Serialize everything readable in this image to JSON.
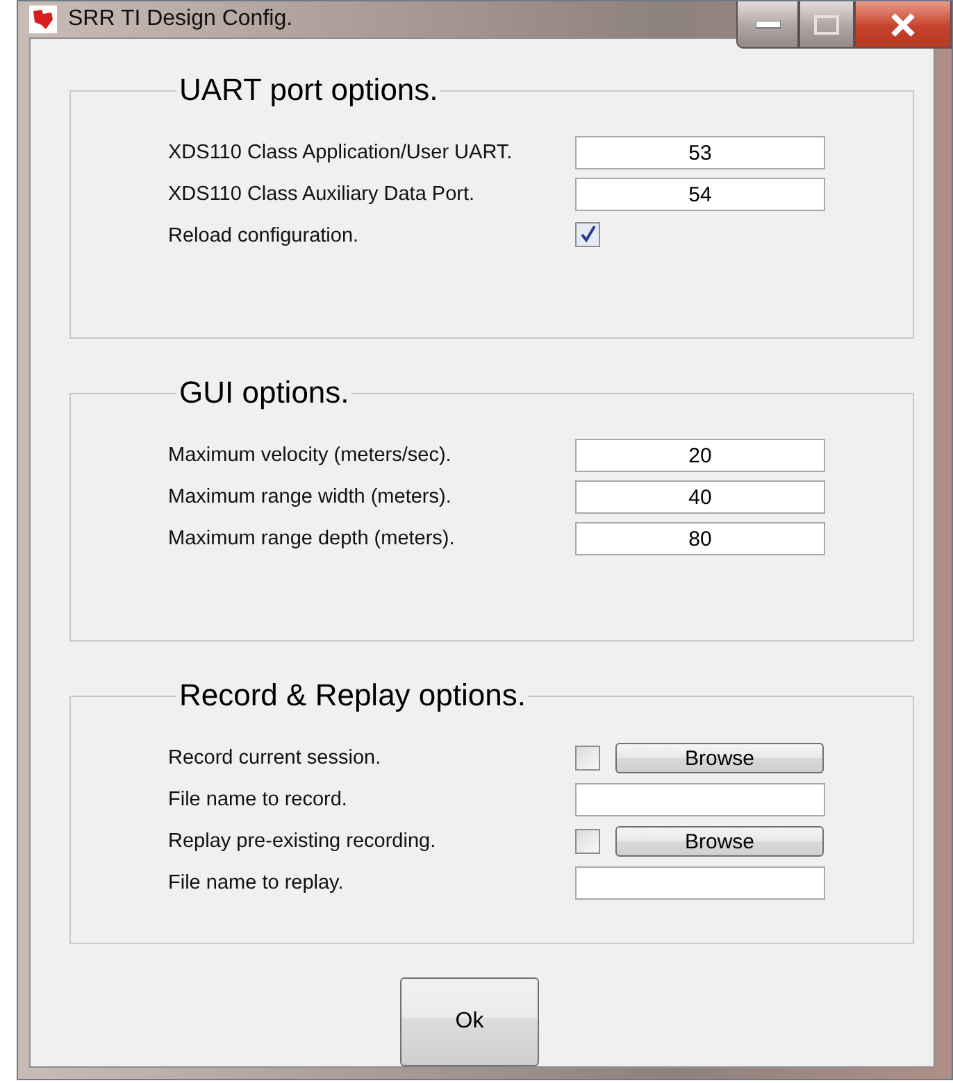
{
  "window": {
    "title": "SRR TI Design Config."
  },
  "groups": [
    {
      "title": "UART port options.",
      "rows": [
        {
          "kind": "field",
          "label": "XDS110 Class Application/User UART.",
          "value": "53"
        },
        {
          "kind": "field",
          "label": "XDS110 Class Auxiliary Data Port.",
          "value": "54"
        },
        {
          "kind": "checkbox",
          "label": "Reload configuration.",
          "checked": true
        }
      ]
    },
    {
      "title": "GUI options.",
      "rows": [
        {
          "kind": "field",
          "label": "Maximum velocity (meters/sec).",
          "value": "20"
        },
        {
          "kind": "field",
          "label": "Maximum range width (meters).",
          "value": "40"
        },
        {
          "kind": "field",
          "label": "Maximum range depth (meters).",
          "value": "80"
        }
      ]
    },
    {
      "title": "Record & Replay options.",
      "rows": [
        {
          "kind": "browse",
          "label": "Record current session.",
          "checked": false,
          "button": "Browse"
        },
        {
          "kind": "field",
          "label": "File name to record."
        },
        {
          "kind": "browse",
          "label": "Replay pre-existing recording.",
          "checked": false,
          "button": "Browse"
        },
        {
          "kind": "field",
          "label": "File name to replay."
        }
      ]
    }
  ],
  "ok_button": "Ok"
}
